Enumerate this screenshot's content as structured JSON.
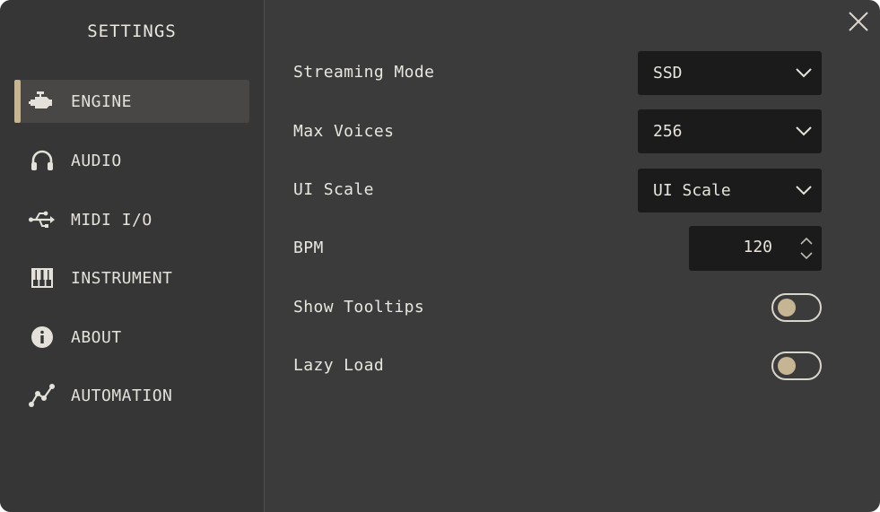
{
  "sidebar": {
    "title": "SETTINGS",
    "items": [
      {
        "label": "ENGINE",
        "icon": "engine-icon",
        "active": true
      },
      {
        "label": "AUDIO",
        "icon": "headphones-icon",
        "active": false
      },
      {
        "label": "MIDI I/O",
        "icon": "usb-icon",
        "active": false
      },
      {
        "label": "INSTRUMENT",
        "icon": "piano-icon",
        "active": false
      },
      {
        "label": "ABOUT",
        "icon": "info-icon",
        "active": false
      },
      {
        "label": "AUTOMATION",
        "icon": "automation-icon",
        "active": false
      }
    ]
  },
  "settings": {
    "streaming_mode": {
      "label": "Streaming Mode",
      "value": "SSD"
    },
    "max_voices": {
      "label": "Max Voices",
      "value": "256"
    },
    "ui_scale": {
      "label": "UI Scale",
      "value": "UI Scale"
    },
    "bpm": {
      "label": "BPM",
      "value": "120"
    },
    "show_tooltips": {
      "label": "Show Tooltips",
      "on": false
    },
    "lazy_load": {
      "label": "Lazy Load",
      "on": false
    }
  },
  "colors": {
    "accent": "#c5b592",
    "background": "#3b3b3b",
    "sidebar": "#363636",
    "control": "#1b1b1b",
    "text": "#e8e6df"
  }
}
